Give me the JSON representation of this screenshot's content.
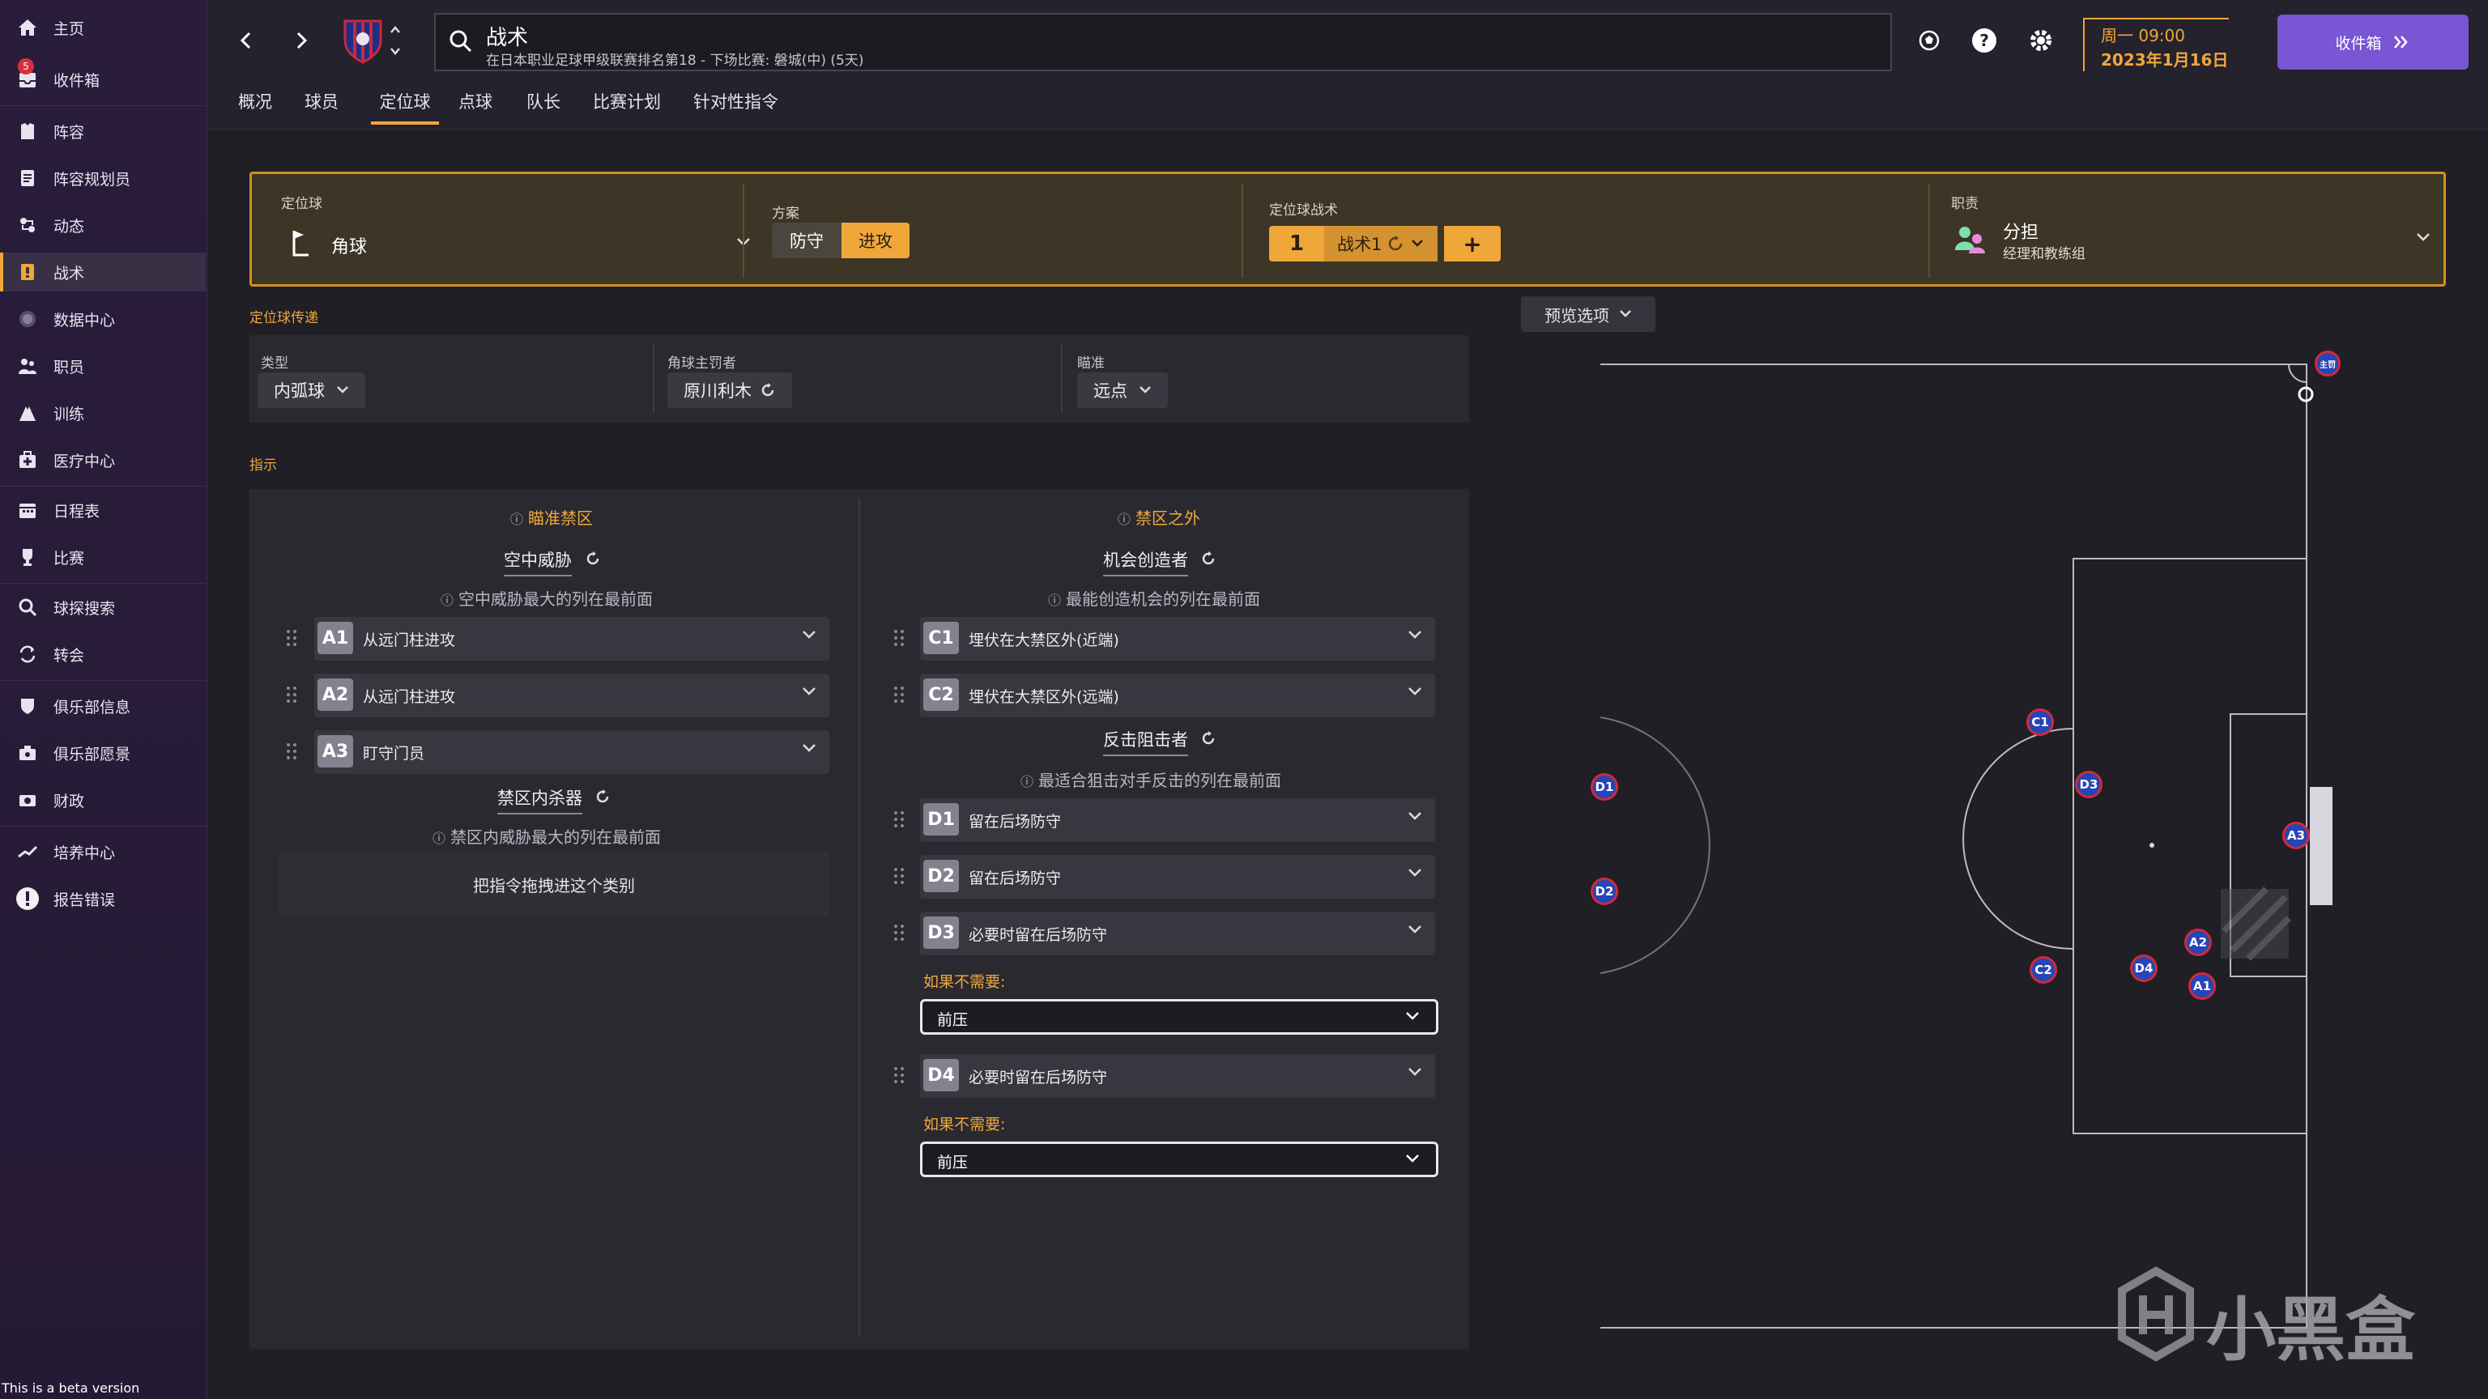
{
  "sidebar": {
    "items": [
      {
        "label": "主页",
        "icon": "home-icon"
      },
      {
        "label": "收件箱",
        "icon": "inbox-icon",
        "badge": "5"
      },
      {
        "label": "阵容",
        "icon": "squad-icon"
      },
      {
        "label": "阵容规划员",
        "icon": "squad-planner-icon"
      },
      {
        "label": "动态",
        "icon": "dynamics-icon"
      },
      {
        "label": "战术",
        "icon": "tactics-icon"
      },
      {
        "label": "数据中心",
        "icon": "data-hub-icon"
      },
      {
        "label": "职员",
        "icon": "staff-icon"
      },
      {
        "label": "训练",
        "icon": "training-icon"
      },
      {
        "label": "医疗中心",
        "icon": "medical-icon"
      },
      {
        "label": "日程表",
        "icon": "schedule-icon"
      },
      {
        "label": "比赛",
        "icon": "trophy-icon"
      },
      {
        "label": "球探搜索",
        "icon": "scouting-icon"
      },
      {
        "label": "转会",
        "icon": "transfers-icon"
      },
      {
        "label": "俱乐部信息",
        "icon": "club-info-icon"
      },
      {
        "label": "俱乐部愿景",
        "icon": "club-vision-icon"
      },
      {
        "label": "财政",
        "icon": "finances-icon"
      },
      {
        "label": "培养中心",
        "icon": "development-icon"
      },
      {
        "label": "报告错误",
        "icon": "report-bug-icon"
      }
    ],
    "beta_text": "This is a beta version"
  },
  "topbar": {
    "title": "战术",
    "subtitle": "在日本职业足球甲级联赛排名第18 - 下场比赛: 磐城(中) (5天)",
    "date_line1": "周一 09:00",
    "date_line2": "2023年1月16日",
    "inbox_button": "收件箱"
  },
  "tabs": [
    "概况",
    "球员",
    "定位球",
    "点球",
    "队长",
    "比赛计划",
    "针对性指令"
  ],
  "active_tab": "定位球",
  "header": {
    "setpiece_caption": "定位球",
    "setpiece_value": "角球",
    "plan_caption": "方案",
    "plan_options": [
      "防守",
      "进攻"
    ],
    "plan_selected": "进攻",
    "routine_caption": "定位球战术",
    "routine_number": "1",
    "routine_name": "战术1",
    "routine_add": "+",
    "duty_caption": "职责",
    "duty_value": "分担",
    "duty_sub": "经理和教练组"
  },
  "delivery": {
    "section_title": "定位球传递",
    "type_caption": "类型",
    "type_value": "内弧球",
    "taker_caption": "角球主罚者",
    "taker_value": "原川利木",
    "target_caption": "瞄准",
    "target_value": "远点"
  },
  "instructions": {
    "section_title": "指示",
    "left_title": "瞄准禁区",
    "right_title": "禁区之外",
    "aerial_title": "空中威胁",
    "aerial_hint": "空中威胁最大的列在最前面",
    "aerial_rows": [
      {
        "tag": "A1",
        "text": "从远门柱进攻"
      },
      {
        "tag": "A2",
        "text": "从远门柱进攻"
      },
      {
        "tag": "A3",
        "text": "盯守门员"
      }
    ],
    "box_killer_title": "禁区内杀器",
    "box_killer_hint": "禁区内威胁最大的列在最前面",
    "drop_zone": "把指令拖拽进这个类别",
    "creator_title": "机会创造者",
    "creator_hint": "最能创造机会的列在最前面",
    "creator_rows": [
      {
        "tag": "C1",
        "text": "埋伏在大禁区外(近端)"
      },
      {
        "tag": "C2",
        "text": "埋伏在大禁区外(远端)"
      }
    ],
    "counter_title": "反击阻击者",
    "counter_hint": "最适合狙击对手反击的列在最前面",
    "counter_rows": [
      {
        "tag": "D1",
        "text": "留在后场防守"
      },
      {
        "tag": "D2",
        "text": "留在后场防守"
      },
      {
        "tag": "D3",
        "text": "必要时留在后场防守"
      },
      {
        "tag": "D4",
        "text": "必要时留在后场防守"
      }
    ],
    "if_not_needed": "如果不需要:",
    "if_not_value_d3": "前压",
    "if_not_value_d4": "前压"
  },
  "pitch": {
    "preview_button": "预览选项",
    "players": [
      "A1",
      "A2",
      "A3",
      "C1",
      "C2",
      "D1",
      "D2",
      "D3",
      "D4"
    ],
    "taker_tag": "主罚"
  },
  "watermark": "小黑盒",
  "colors": {
    "accent": "#f0a73a",
    "primary_button": "#7a55d4",
    "player_fill": "#2645b8",
    "player_ring": "#d02a3a"
  }
}
